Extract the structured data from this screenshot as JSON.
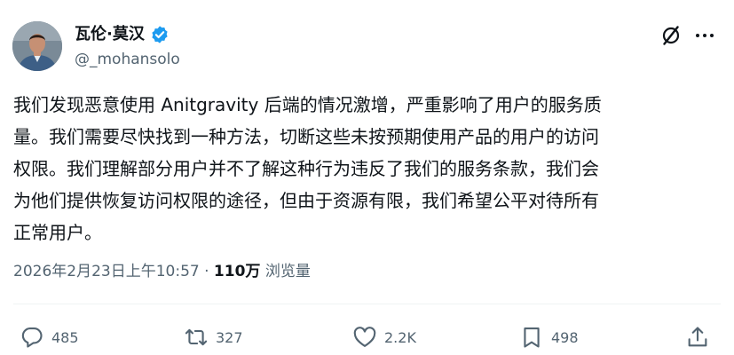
{
  "author": {
    "display_name": "瓦伦·莫汉",
    "handle": "@_mohansolo",
    "verified": true
  },
  "post": {
    "lines": [
      "我们发现恶意使用 Anitgravity 后端的情况激增，严重影响了用户的服务质",
      "量。我们需要尽快找到一种方法，切断这些未按预期使用产品的用户的访问",
      "权限。我们理解部分用户并不了解这种行为违反了我们的服务条款，我们会",
      "为他们提供恢复访问权限的途径，但由于资源有限，我们希望公平对待所有",
      "正常用户。"
    ],
    "timestamp": "2026年2月23日上午10:57",
    "separator": "·",
    "views_count": "110万",
    "views_label": "浏览量"
  },
  "actions": {
    "replies": "485",
    "reposts": "327",
    "likes": "2.2K",
    "bookmarks": "498"
  },
  "colors": {
    "text": "#0f1419",
    "secondary": "#536471",
    "verified_badge": "#1d9bf0",
    "divider": "#eff3f4"
  },
  "icons": [
    "grok-icon",
    "more-icon",
    "reply-icon",
    "repost-icon",
    "like-icon",
    "bookmark-icon",
    "share-icon"
  ]
}
